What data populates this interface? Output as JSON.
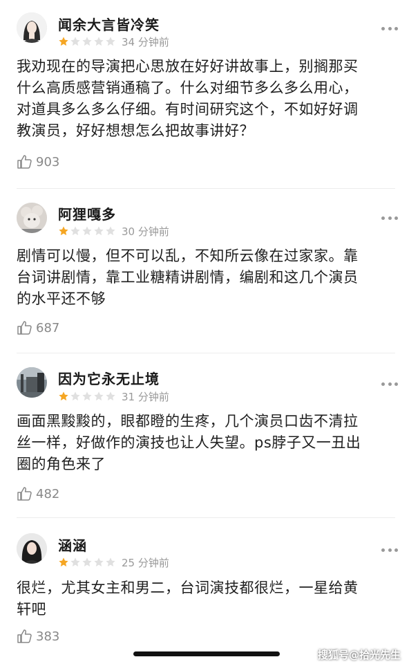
{
  "comments": [
    {
      "username": "闻余大言皆冷笑",
      "rating": 1,
      "max_rating": 5,
      "time": "34 分钟前",
      "text_lines": [
        "我劝现在的导演把心思放在好好讲故事上，别搁那买",
        "什么高质感营销通稿了。什么对细节多么多么用心，",
        "对道具多么多么仔细。有时间研究这个，不如好好调",
        "教演员，好好想想怎么把故事讲好？"
      ],
      "likes": "903"
    },
    {
      "username": "阿狸嘎多",
      "rating": 1,
      "max_rating": 5,
      "time": "30 分钟前",
      "text_lines": [
        "剧情可以慢，但不可以乱，不知所云像在过家家。靠",
        "台词讲剧情，靠工业糖精讲剧情，编剧和这几个演员",
        "的水平还不够"
      ],
      "likes": "687"
    },
    {
      "username": "因为它永无止境",
      "rating": 1,
      "max_rating": 5,
      "time": "31 分钟前",
      "text_lines": [
        "画面黑黢黢的，眼都瞪的生疼，几个演员口齿不清拉",
        "丝一样，好做作的演技也让人失望。ps脖子又一丑出",
        "圈的角色来了"
      ],
      "likes": "482"
    },
    {
      "username": "涵涵",
      "rating": 1,
      "max_rating": 5,
      "time": "25 分钟前",
      "text_lines": [
        "很烂，尤其女主和男二，台词演技都很烂，一星给黄",
        "轩吧"
      ],
      "likes": "383"
    }
  ],
  "watermark": "搜狐号@拾光先生",
  "colors": {
    "star_filled": "#f5a623",
    "star_empty": "#e0e0e0",
    "muted_text": "#999999"
  }
}
